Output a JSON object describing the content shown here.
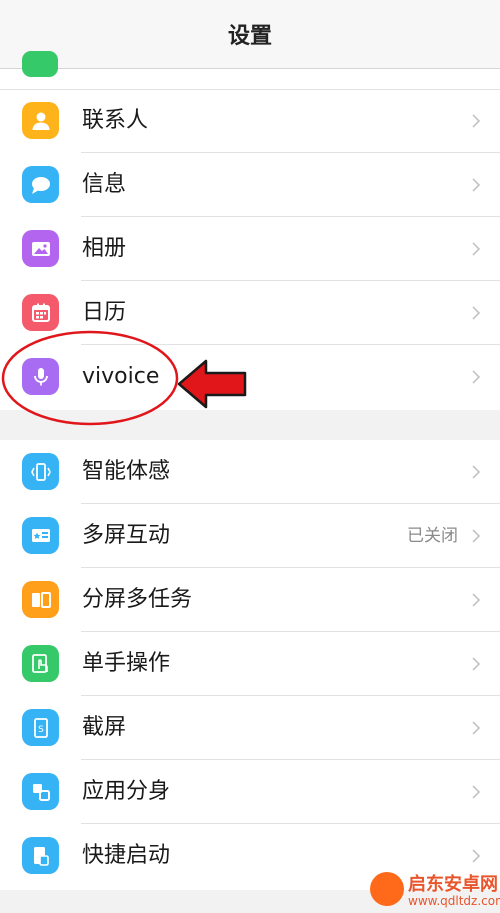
{
  "header": {
    "title": "设置"
  },
  "group1": {
    "items": [
      {
        "label": "联系人",
        "icon": "contact-person-icon",
        "color": "#ffb31a"
      },
      {
        "label": "信息",
        "icon": "message-bubble-icon",
        "color": "#36b3f5"
      },
      {
        "label": "相册",
        "icon": "photo-album-icon",
        "color": "#b365f0"
      },
      {
        "label": "日历",
        "icon": "calendar-icon",
        "color": "#f55a6c"
      },
      {
        "label": "vivoice",
        "icon": "microphone-icon",
        "color": "#a86cf2"
      }
    ]
  },
  "group2": {
    "items": [
      {
        "label": "智能体感",
        "icon": "smart-motion-icon",
        "color": "#36b3f5"
      },
      {
        "label": "多屏互动",
        "icon": "multi-screen-icon",
        "color": "#36b3f5",
        "status": "已关闭"
      },
      {
        "label": "分屏多任务",
        "icon": "split-screen-icon",
        "color": "#ff9f1a"
      },
      {
        "label": "单手操作",
        "icon": "one-hand-icon",
        "color": "#35c96a"
      },
      {
        "label": "截屏",
        "icon": "screenshot-icon",
        "color": "#36b3f5"
      },
      {
        "label": "应用分身",
        "icon": "app-clone-icon",
        "color": "#36b3f5"
      },
      {
        "label": "快捷启动",
        "icon": "quick-launch-icon",
        "color": "#36b3f5"
      }
    ]
  },
  "annotation": {
    "color": "#e0161b"
  },
  "watermark": {
    "title": "启东安卓网",
    "url": "www.qdltdz.com"
  }
}
